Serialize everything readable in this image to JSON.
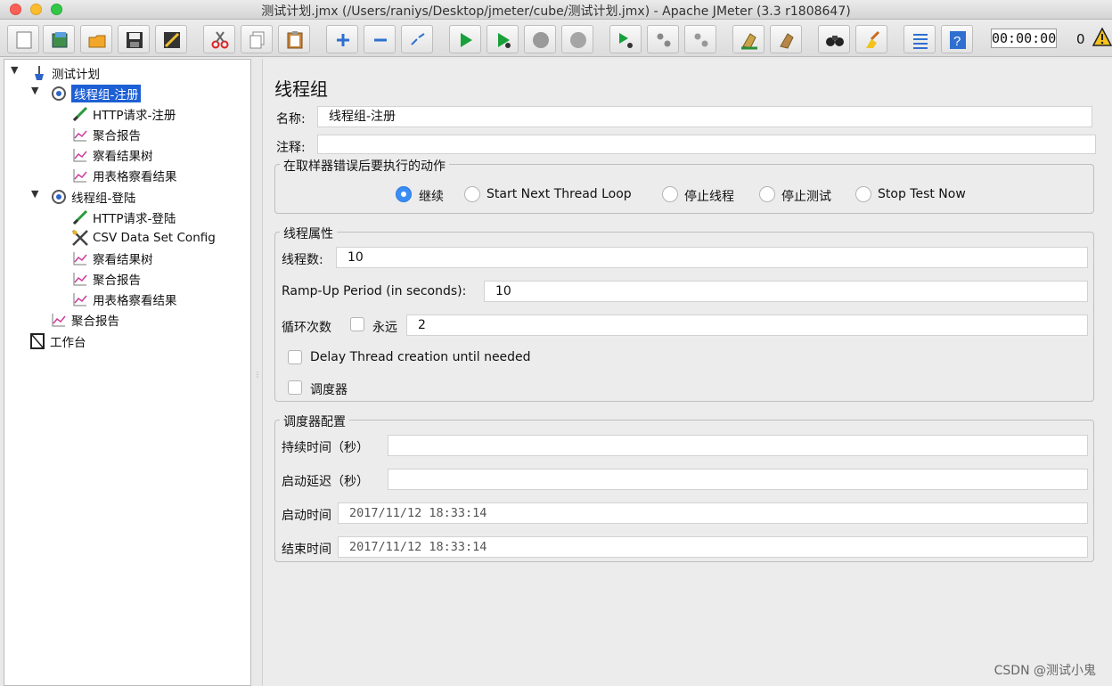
{
  "window": {
    "title": "测试计划.jmx (/Users/raniys/Desktop/jmeter/cube/测试计划.jmx) - Apache JMeter (3.3 r1808647)"
  },
  "toolbar": {
    "timer": "00:00:00",
    "error_count": "0",
    "buttons": [
      "new-icon",
      "templates-icon",
      "open-icon",
      "save-icon",
      "save-as-icon",
      "cut-icon",
      "copy-icon",
      "paste-icon",
      "expand-icon",
      "collapse-icon",
      "toggle-icon",
      "start-icon",
      "start-no-pause-icon",
      "stop-icon",
      "shutdown-icon",
      "remote-start-icon",
      "remote-stop-icon",
      "remote-shutdown-icon",
      "clear-icon",
      "clear-all-icon",
      "search-icon",
      "reset-search-icon",
      "function-helper-icon",
      "help-icon"
    ]
  },
  "tree": {
    "items": [
      {
        "label": "测试计划",
        "icon": "test-plan-icon"
      },
      {
        "label": "线程组-注册",
        "icon": "thread-group-icon"
      },
      {
        "label": "HTTP请求-注册",
        "icon": "sampler-icon"
      },
      {
        "label": "聚合报告",
        "icon": "listener-icon"
      },
      {
        "label": "察看结果树",
        "icon": "listener-icon"
      },
      {
        "label": "用表格察看结果",
        "icon": "listener-icon"
      },
      {
        "label": "线程组-登陆",
        "icon": "thread-group-icon"
      },
      {
        "label": "HTTP请求-登陆",
        "icon": "sampler-icon"
      },
      {
        "label": "CSV Data Set Config",
        "icon": "config-icon"
      },
      {
        "label": "察看结果树",
        "icon": "listener-icon"
      },
      {
        "label": "聚合报告",
        "icon": "listener-icon"
      },
      {
        "label": "用表格察看结果",
        "icon": "listener-icon"
      },
      {
        "label": "聚合报告",
        "icon": "listener-icon"
      },
      {
        "label": "工作台",
        "icon": "workbench-icon"
      }
    ]
  },
  "panel": {
    "title": "线程组",
    "name_label": "名称:",
    "name_value": "线程组-注册",
    "comment_label": "注释:",
    "comment_value": "",
    "error_action": {
      "legend": "在取样器错误后要执行的动作",
      "options": [
        "继续",
        "Start Next Thread Loop",
        "停止线程",
        "停止测试",
        "Stop Test Now"
      ],
      "selected": "继续"
    },
    "thread_props": {
      "legend": "线程属性",
      "threads_label": "线程数:",
      "threads_value": "10",
      "rampup_label": "Ramp-Up Period (in seconds):",
      "rampup_value": "10",
      "loop_label": "循环次数",
      "forever_label": "永远",
      "loop_value": "2",
      "delay_label": "Delay Thread creation until needed",
      "scheduler_label": "调度器"
    },
    "scheduler": {
      "legend": "调度器配置",
      "duration_label": "持续时间（秒）",
      "duration_value": "",
      "delay_label": "启动延迟（秒）",
      "delay_value": "",
      "start_label": "启动时间",
      "start_value": "2017/11/12 18:33:14",
      "end_label": "结束时间",
      "end_value": "2017/11/12 18:33:14"
    }
  },
  "watermark": "CSDN @测试小鬼"
}
